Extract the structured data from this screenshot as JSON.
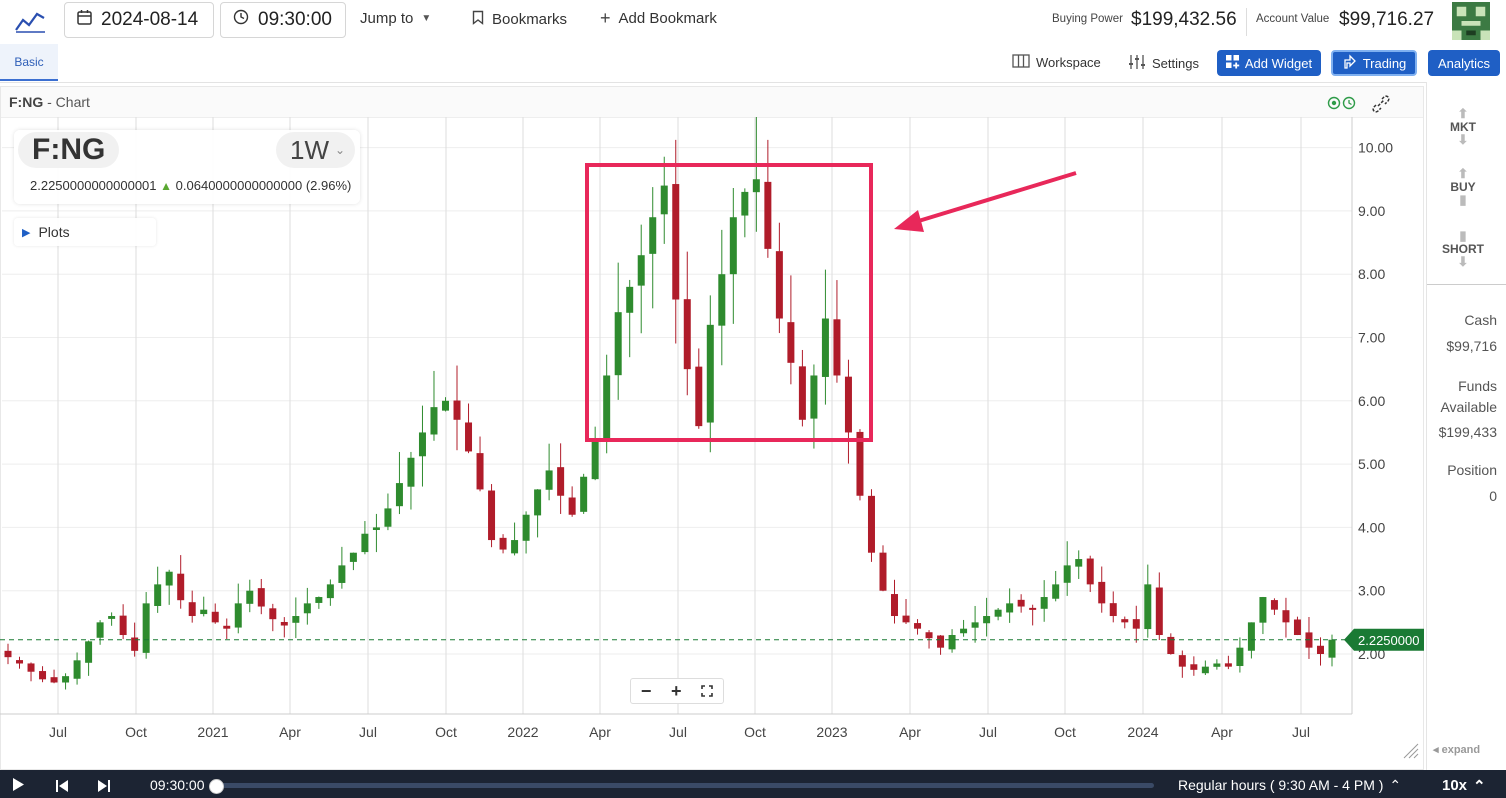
{
  "topbar": {
    "date": "2024-08-14",
    "time": "09:30:00",
    "jump_to": "Jump to",
    "bookmarks": "Bookmarks",
    "add_bookmark": "Add Bookmark",
    "buying_power_label": "Buying Power",
    "buying_power_value": "$199,432.56",
    "account_value_label": "Account Value",
    "account_value_value": "$99,716.27"
  },
  "tabs": {
    "basic": "Basic"
  },
  "toolbar": {
    "workspace": "Workspace",
    "settings": "Settings",
    "add_widget": "Add Widget",
    "trading": "Trading",
    "analytics": "Analytics"
  },
  "chart_panel": {
    "title": "F:NG",
    "subtitle": "Chart",
    "symbol": "F:NG",
    "timeframe": "1W",
    "last_price": "2.2250000000000001",
    "change": "0.0640000000000000",
    "change_pct": "(2.96%)",
    "plots_label": "Plots",
    "price_tag": "2.2250000"
  },
  "sidebar": {
    "mkt": "MKT",
    "buy": "BUY",
    "short": "SHORT",
    "cash_label": "Cash",
    "cash_value": "$99,716",
    "funds_label": "Funds Available",
    "funds_value": "$199,433",
    "position_label": "Position",
    "position_value": "0",
    "expand": "expand"
  },
  "bottombar": {
    "time": "09:30:00",
    "hours": "Regular hours ( 9:30 AM - 4 PM )",
    "speed": "10x"
  },
  "colors": {
    "up": "#2e8b2e",
    "down": "#b01c2a",
    "annotation": "#e8285a",
    "accent": "#1f5fc5",
    "price_tag": "#1a7a34"
  },
  "chart_data": {
    "type": "candlestick",
    "y_ticks": [
      "2.00",
      "3.00",
      "4.00",
      "5.00",
      "6.00",
      "7.00",
      "8.00",
      "9.00",
      "10.00"
    ],
    "ylim": [
      1.0,
      10.5
    ],
    "x_ticks": [
      "Jul",
      "Oct",
      "2021",
      "Apr",
      "Jul",
      "Oct",
      "2022",
      "Apr",
      "Jul",
      "Oct",
      "2023",
      "Apr",
      "Jul",
      "Oct",
      "2024",
      "Apr",
      "Jul"
    ],
    "close_series": [
      1.95,
      1.85,
      1.72,
      1.6,
      1.55,
      1.65,
      1.9,
      2.2,
      2.5,
      2.6,
      2.3,
      2.05,
      2.8,
      3.1,
      3.3,
      2.85,
      2.6,
      2.7,
      2.5,
      2.4,
      2.8,
      3.0,
      2.75,
      2.55,
      2.45,
      2.6,
      2.8,
      2.9,
      3.1,
      3.4,
      3.6,
      3.9,
      4.0,
      4.3,
      4.7,
      5.1,
      5.5,
      5.9,
      6.0,
      5.7,
      5.2,
      4.6,
      3.8,
      3.65,
      3.8,
      4.2,
      4.6,
      4.9,
      4.5,
      4.2,
      4.8,
      5.4,
      6.4,
      7.4,
      7.8,
      8.3,
      8.9,
      9.4,
      7.6,
      6.5,
      5.6,
      7.2,
      8.0,
      8.9,
      9.3,
      9.5,
      8.4,
      7.3,
      6.6,
      5.7,
      6.4,
      7.3,
      6.4,
      5.5,
      4.5,
      3.6,
      3.0,
      2.6,
      2.5,
      2.4,
      2.25,
      2.1,
      2.3,
      2.4,
      2.5,
      2.6,
      2.7,
      2.8,
      2.75,
      2.7,
      2.9,
      3.1,
      3.4,
      3.5,
      3.1,
      2.8,
      2.6,
      2.5,
      2.4,
      3.1,
      2.3,
      2.0,
      1.8,
      1.75,
      1.8,
      1.85,
      1.8,
      2.1,
      2.5,
      2.9,
      2.7,
      2.5,
      2.3,
      2.1,
      2.0,
      2.225
    ],
    "annotation": "highlight box with arrow around 2022 peak"
  }
}
